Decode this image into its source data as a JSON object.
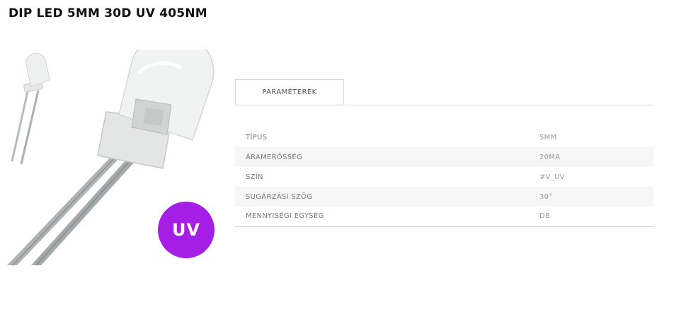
{
  "product": {
    "title": "DIP LED 5MM 30D UV 405NM",
    "badge_text": "UV",
    "badge_color": "#a51ee6"
  },
  "tabs": [
    {
      "label": "PARAMÉTEREK",
      "active": true
    }
  ],
  "specs": [
    {
      "name": "TÍPUS",
      "value": "5MM"
    },
    {
      "name": "ÁRAMERŐSSÉG",
      "value": "20MA"
    },
    {
      "name": "SZÍN",
      "value": "#V_UV"
    },
    {
      "name": "SUGÁRZÁSI SZÖG",
      "value": "30°"
    },
    {
      "name": "MENNYISÉGI EGYSÉG",
      "value": "DB"
    }
  ]
}
